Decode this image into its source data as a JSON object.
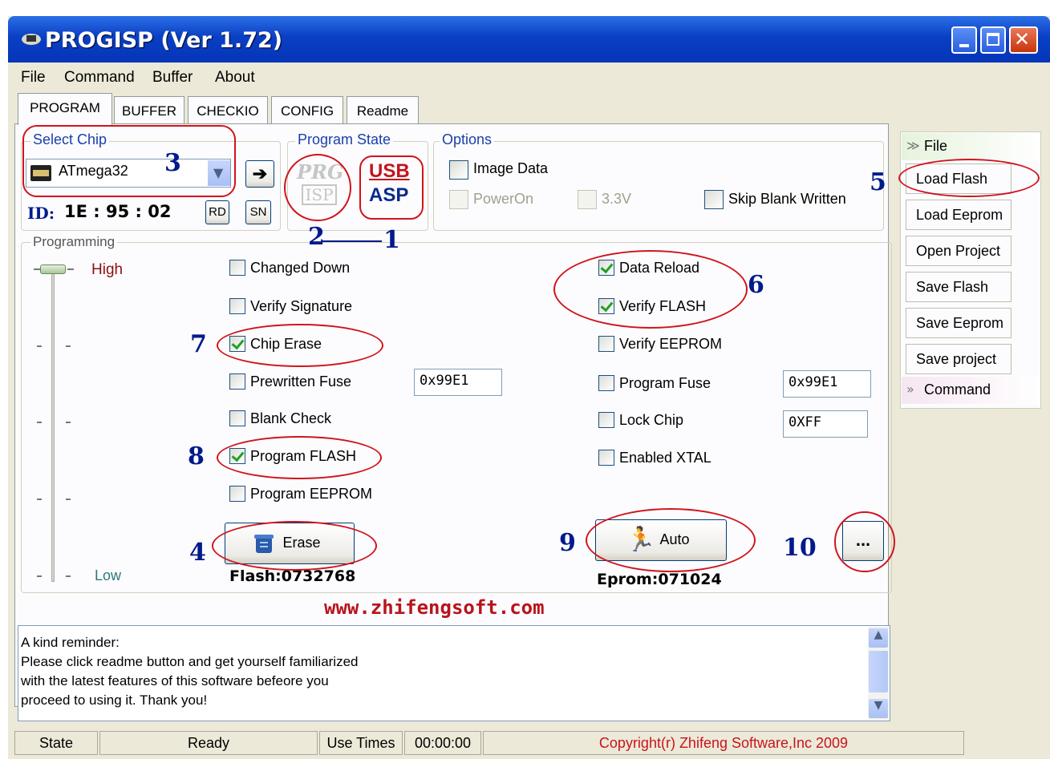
{
  "window": {
    "title": "PROGISP (Ver 1.72)"
  },
  "menu": [
    "File",
    "Command",
    "Buffer",
    "About"
  ],
  "tabs": [
    "PROGRAM",
    "BUFFER",
    "CHECKIO",
    "CONFIG",
    "Readme"
  ],
  "select_chip": {
    "label": "Select Chip",
    "value": "ATmega32",
    "id_label": "ID:",
    "id_value": "1E : 95 : 02",
    "rd_label": "RD",
    "sn_label": "SN"
  },
  "program_state": {
    "label": "Program State",
    "prg_top": "PRG",
    "prg_bottom": "ISP",
    "usb_top": "USB",
    "usb_bottom": "ASP"
  },
  "options": {
    "label": "Options",
    "image_data": "Image Data",
    "power_on": "PowerOn",
    "v33": "3.3V",
    "skip_blank": "Skip Blank Written"
  },
  "programming": {
    "label": "Programming",
    "high": "High",
    "low": "Low",
    "left_options": [
      {
        "label": "Changed Down",
        "checked": false
      },
      {
        "label": "Verify Signature",
        "checked": false
      },
      {
        "label": "Chip Erase",
        "checked": true
      },
      {
        "label": "Prewritten Fuse",
        "checked": false
      },
      {
        "label": "Blank Check",
        "checked": false
      },
      {
        "label": "Program FLASH",
        "checked": true
      },
      {
        "label": "Program EEPROM",
        "checked": false
      }
    ],
    "right_options": [
      {
        "label": "Data Reload",
        "checked": true
      },
      {
        "label": "Verify FLASH",
        "checked": true
      },
      {
        "label": "Verify EEPROM",
        "checked": false
      },
      {
        "label": "Program Fuse",
        "checked": false
      },
      {
        "label": "Lock Chip",
        "checked": false
      },
      {
        "label": "Enabled XTAL",
        "checked": false
      }
    ],
    "prewritten_fuse_value": "0x99E1",
    "program_fuse_value": "0x99E1",
    "lock_chip_value": "0XFF",
    "erase_label": "Erase",
    "auto_label": "Auto",
    "more_label": "...",
    "flash_info": "Flash:0732768",
    "eprom_info": "Eprom:071024"
  },
  "website": "www.zhifengsoft.com",
  "reminder": {
    "lines": [
      "A kind reminder:",
      "Please click readme button and get yourself familiarized",
      "with the latest features of this software befeore you",
      "proceed to using it. Thank you!"
    ]
  },
  "sidebar": {
    "file_header": "File",
    "buttons": [
      "Load Flash",
      "Load Eeprom",
      "Open Project",
      "Save Flash",
      "Save Eeprom",
      "Save project"
    ],
    "command_header": "Command"
  },
  "status": {
    "state_label": "State",
    "state_value": "Ready",
    "use_times_label": "Use Times",
    "use_times_value": "00:00:00",
    "copyright": "Copyright(r) Zhifeng Software,Inc 2009"
  },
  "annotations": [
    "1",
    "2",
    "3",
    "4",
    "5",
    "6",
    "7",
    "8",
    "9",
    "10"
  ],
  "colors": {
    "titlebar": "#0a3fc4",
    "annotation_red": "#d0141c",
    "annotation_blue": "#001a8c",
    "group_label": "#1a3fa8"
  }
}
